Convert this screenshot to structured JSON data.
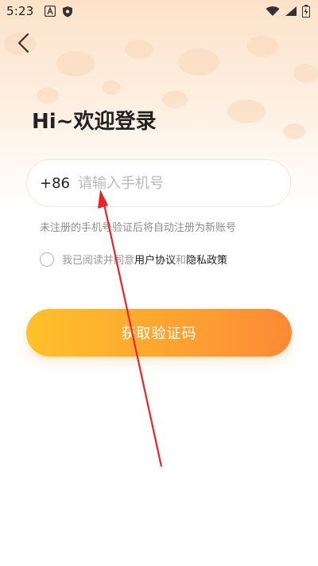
{
  "status_bar": {
    "time": "5:23"
  },
  "login": {
    "title": "Hi~欢迎登录",
    "country_code": "+86",
    "phone_placeholder": "请输入手机号",
    "phone_value": "",
    "hint": "未注册的手机号验证后将自动注册为新账号",
    "agree_prefix": "我已阅读并同意",
    "user_agreement": "用户协议",
    "agree_and": "和",
    "privacy_policy": "隐私政策",
    "get_code_label": "获取验证码"
  },
  "colors": {
    "button_start": "#fec22a",
    "button_end": "#fd8a35",
    "annotation_arrow": "#e8232b"
  },
  "icons": [
    "back-arrow-icon",
    "signal-icon",
    "wifi-icon",
    "battery-icon"
  ]
}
